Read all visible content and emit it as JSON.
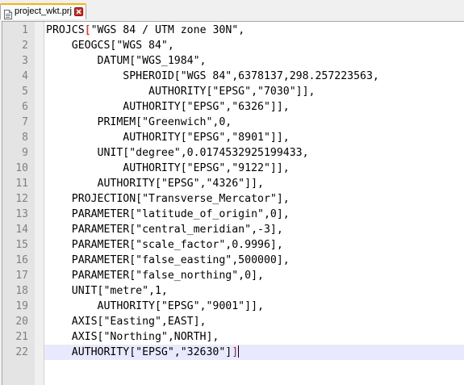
{
  "tab": {
    "filename": "project_wkt.prj",
    "icon": "file-icon",
    "close_icon": "close-icon",
    "accent_color": "#f7b40f"
  },
  "editor": {
    "current_line": 22,
    "lines": [
      {
        "num": "1",
        "text": "PROJCS[\"WGS 84 / UTM zone 30N\","
      },
      {
        "num": "2",
        "text": "    GEOGCS[\"WGS 84\","
      },
      {
        "num": "3",
        "text": "        DATUM[\"WGS_1984\","
      },
      {
        "num": "4",
        "text": "            SPHEROID[\"WGS 84\",6378137,298.257223563,"
      },
      {
        "num": "5",
        "text": "                AUTHORITY[\"EPSG\",\"7030\"]],"
      },
      {
        "num": "6",
        "text": "            AUTHORITY[\"EPSG\",\"6326\"]],"
      },
      {
        "num": "7",
        "text": "        PRIMEM[\"Greenwich\",0,"
      },
      {
        "num": "8",
        "text": "            AUTHORITY[\"EPSG\",\"8901\"]],"
      },
      {
        "num": "9",
        "text": "        UNIT[\"degree\",0.0174532925199433,"
      },
      {
        "num": "10",
        "text": "            AUTHORITY[\"EPSG\",\"9122\"]],"
      },
      {
        "num": "11",
        "text": "        AUTHORITY[\"EPSG\",\"4326\"]],"
      },
      {
        "num": "12",
        "text": "    PROJECTION[\"Transverse_Mercator\"],"
      },
      {
        "num": "13",
        "text": "    PARAMETER[\"latitude_of_origin\",0],"
      },
      {
        "num": "14",
        "text": "    PARAMETER[\"central_meridian\",-3],"
      },
      {
        "num": "15",
        "text": "    PARAMETER[\"scale_factor\",0.9996],"
      },
      {
        "num": "16",
        "text": "    PARAMETER[\"false_easting\",500000],"
      },
      {
        "num": "17",
        "text": "    PARAMETER[\"false_northing\",0],"
      },
      {
        "num": "18",
        "text": "    UNIT[\"metre\",1,"
      },
      {
        "num": "19",
        "text": "        AUTHORITY[\"EPSG\",\"9001\"]],"
      },
      {
        "num": "20",
        "text": "    AXIS[\"Easting\",EAST],"
      },
      {
        "num": "21",
        "text": "    AXIS[\"Northing\",NORTH],"
      },
      {
        "num": "22",
        "text": "    AUTHORITY[\"EPSG\",\"32630\"]]"
      }
    ]
  }
}
